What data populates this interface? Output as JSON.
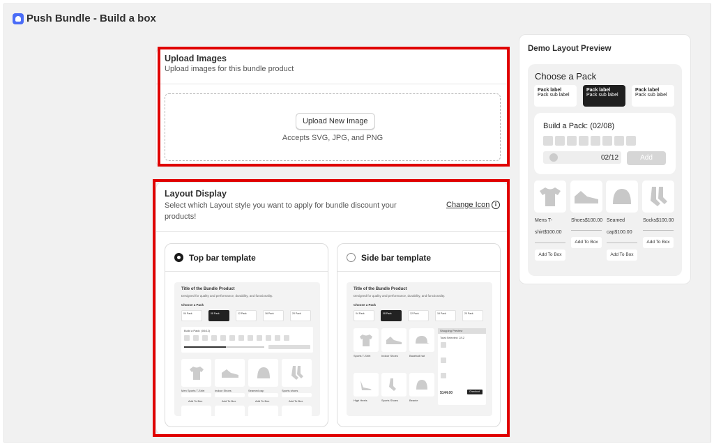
{
  "app": {
    "title": "Push Bundle - Build a box"
  },
  "upload": {
    "title": "Upload Images",
    "subtitle": "Upload images for this bundle product",
    "button": "Upload New Image",
    "accepts": "Accepts SVG, JPG, and PNG"
  },
  "layout": {
    "title": "Layout Display",
    "subtitle": "Select which Layout style you want to apply for bundle discount your products!",
    "change_icon": "Change Icon",
    "templates": [
      {
        "label": "Top bar template",
        "selected": true
      },
      {
        "label": "Side bar template",
        "selected": false
      }
    ],
    "mock": {
      "title": "Title of the Bundle Product",
      "desc": "Designed for quality and performance, durability, and functionality.",
      "choose": "Choose a Pack",
      "packs": [
        "04 Pack",
        "08 Pack",
        "12 Pack",
        "16 Pack",
        "20 Pack"
      ],
      "pack_sub": "$##/Per Bundle",
      "build": "Build a Pack: (00/12)",
      "products_top": [
        "Men Sports T-Shirt",
        "Indoor Shoes",
        "Seamed cap",
        "Sports shoes"
      ],
      "products_side": [
        "Sports T-Shirt",
        "Indoor Shoes",
        "Baseball hat",
        "High Heels",
        "Sports Shoes",
        "Beanie"
      ],
      "add": "Add To Box",
      "shopping": "Shopping Preview",
      "selected": "Total Selected: 2/12",
      "subtotal": "$144.00",
      "checkout": "Checkout"
    }
  },
  "preview": {
    "title": "Demo Layout Preview",
    "choose": "Choose a Pack",
    "packs": [
      {
        "label": "Pack label",
        "sub": "Pack sub label"
      },
      {
        "label": "Pack label",
        "sub": "Pack sub label"
      },
      {
        "label": "Pack label",
        "sub": "Pack sub label"
      }
    ],
    "build": "Build a Pack: (02/08)",
    "count": "02/12",
    "add": "Add",
    "products": [
      {
        "name": "Mens T-shirt",
        "price": "$100.00",
        "line1": "Mens T-",
        "line2": "shirt$100.00"
      },
      {
        "name": "Shoes",
        "price": "$100.00",
        "line1": "Shoes$100.00"
      },
      {
        "name": "Seamed cap",
        "price": "$100.00",
        "line1": "Seamed",
        "line2": "cap$100.00"
      },
      {
        "name": "Socks",
        "price": "$100.00",
        "line1": "Socks$100.00"
      }
    ],
    "add_to_box": "Add To Box"
  },
  "colors": {
    "highlight": "#e00000",
    "accent": "#4a6cf7"
  }
}
